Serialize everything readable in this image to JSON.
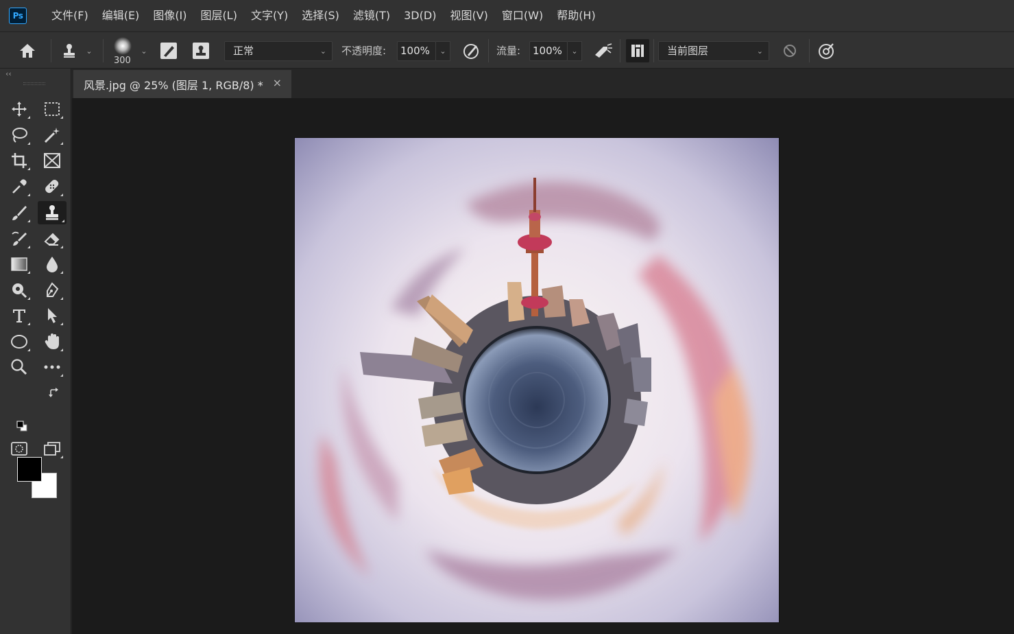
{
  "app": {
    "logo_text": "Ps",
    "menu": [
      "文件(F)",
      "编辑(E)",
      "图像(I)",
      "图层(L)",
      "文字(Y)",
      "选择(S)",
      "滤镜(T)",
      "3D(D)",
      "视图(V)",
      "窗口(W)",
      "帮助(H)"
    ]
  },
  "options_bar": {
    "brush_size": "300",
    "blend_mode": "正常",
    "opacity_label": "不透明度:",
    "opacity_value": "100%",
    "flow_label": "流量:",
    "flow_value": "100%",
    "sample_mode": "当前图层"
  },
  "document": {
    "tab_title": "风景.jpg @ 25% (图层 1, RGB/8) *",
    "close_glyph": "×"
  },
  "toolbar": {
    "collapse_glyph": "‹‹",
    "active_tool": "clone-stamp",
    "foreground_color": "#000000",
    "background_color": "#ffffff"
  },
  "colors": {
    "accent": "#31a8ff",
    "ui_dark": "#323232",
    "canvas_bg": "#1b1b1b"
  }
}
